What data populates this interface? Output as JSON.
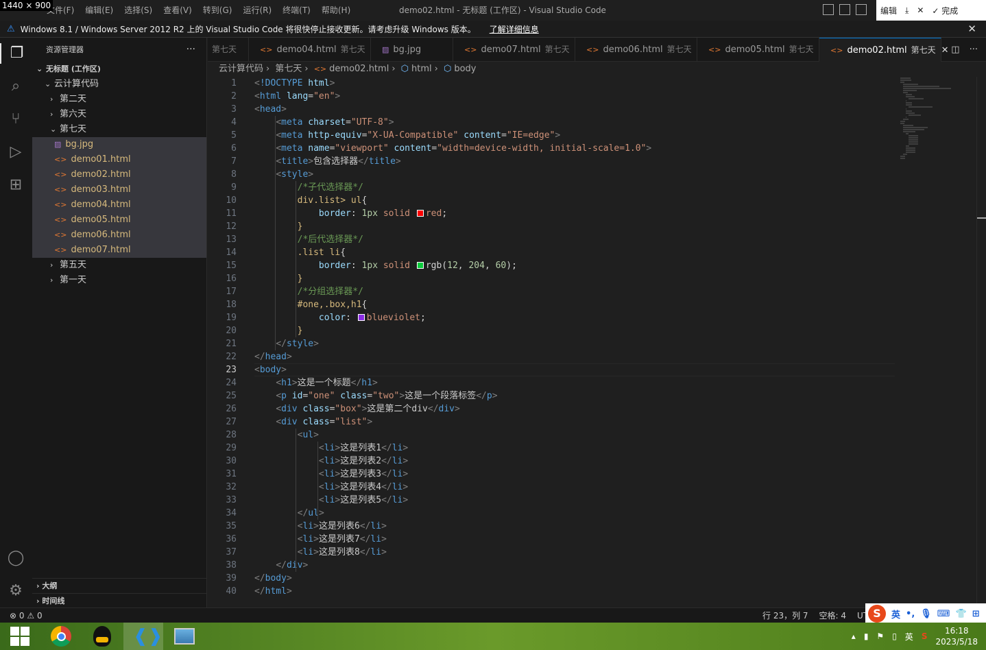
{
  "screen_label": "1440 × 900",
  "menu": [
    "文件(F)",
    "编辑(E)",
    "选择(S)",
    "查看(V)",
    "转到(G)",
    "运行(R)",
    "终端(T)",
    "帮助(H)"
  ],
  "window_title": "demo02.html - 无标题 (工作区) - Visual Studio Code",
  "snip_toolbar": {
    "edit": "编辑",
    "done": "完成"
  },
  "banner": {
    "text": "Windows 8.1 / Windows Server 2012 R2 上的 Visual Studio Code 将很快停止接收更新。请考虑升级 Windows 版本。",
    "link": "了解详细信息"
  },
  "sidebar": {
    "title": "资源管理器",
    "workspace": "无标题 (工作区)",
    "root": "云计算代码",
    "folders_before": [
      "第二天",
      "第六天"
    ],
    "open_folder": "第七天",
    "files": [
      {
        "name": "bg.jpg",
        "type": "image"
      },
      {
        "name": "demo01.html",
        "type": "html"
      },
      {
        "name": "demo02.html",
        "type": "html"
      },
      {
        "name": "demo03.html",
        "type": "html"
      },
      {
        "name": "demo04.html",
        "type": "html"
      },
      {
        "name": "demo05.html",
        "type": "html"
      },
      {
        "name": "demo06.html",
        "type": "html"
      },
      {
        "name": "demo07.html",
        "type": "html"
      }
    ],
    "folders_after": [
      "第五天",
      "第一天"
    ],
    "outline": "大纲",
    "timeline": "时间线"
  },
  "tabs": [
    {
      "name": "",
      "desc": "第七天",
      "type": "partial"
    },
    {
      "name": "demo04.html",
      "desc": "第七天",
      "type": "html"
    },
    {
      "name": "bg.jpg",
      "desc": "",
      "type": "image"
    },
    {
      "name": "demo07.html",
      "desc": "第七天",
      "type": "html"
    },
    {
      "name": "demo06.html",
      "desc": "第七天",
      "type": "html"
    },
    {
      "name": "demo05.html",
      "desc": "第七天",
      "type": "html"
    },
    {
      "name": "demo02.html",
      "desc": "第七天",
      "type": "html",
      "active": true
    }
  ],
  "breadcrumb": [
    "云计算代码",
    "第七天",
    "demo02.html",
    "html",
    "body"
  ],
  "editor": {
    "current_line": 23,
    "lines": [
      "<!DOCTYPE html>",
      "<html lang=\"en\">",
      "<head>",
      "    <meta charset=\"UTF-8\">",
      "    <meta http-equiv=\"X-UA-Compatible\" content=\"IE=edge\">",
      "    <meta name=\"viewport\" content=\"width=device-width, initial-scale=1.0\">",
      "    <title>包含选择器</title>",
      "    <style>",
      "        /*子代选择器*/",
      "        div.list> ul{",
      "            border: 1px solid red;",
      "        }",
      "        /*后代选择器*/",
      "        .list li{",
      "            border: 1px solid rgb(12, 204, 60);",
      "        }",
      "        /*分组选择器*/",
      "        #one,.box,h1{",
      "            color: blueviolet;",
      "        }",
      "    </style>",
      "</head>",
      "<body>",
      "    <h1>这是一个标题</h1>",
      "    <p id=\"one\" class=\"two\">这是一个段落标签</p>",
      "    <div class=\"box\">这是第二个div</div>",
      "    <div class=\"list\">",
      "        <ul>",
      "            <li>这是列表1</li>",
      "            <li>这是列表2</li>",
      "            <li>这是列表3</li>",
      "            <li>这是列表4</li>",
      "            <li>这是列表5</li>",
      "        </ul>",
      "        <li>这是列表6</li>",
      "        <li>这是列表7</li>",
      "        <li>这是列表8</li>",
      "    </div>",
      "</body>",
      "</html>"
    ],
    "swatches": {
      "red": "#ff0000",
      "green": "#0ccc3c",
      "blueviolet": "#8a2be2"
    }
  },
  "status": {
    "errors": "0",
    "warnings": "0",
    "position": "行 23，列 7",
    "spaces": "空格: 4",
    "encoding": "UTF"
  },
  "ime": {
    "lang": "英"
  },
  "taskbar": {
    "lang": "英",
    "time": "16:18",
    "date": "2023/5/18"
  }
}
